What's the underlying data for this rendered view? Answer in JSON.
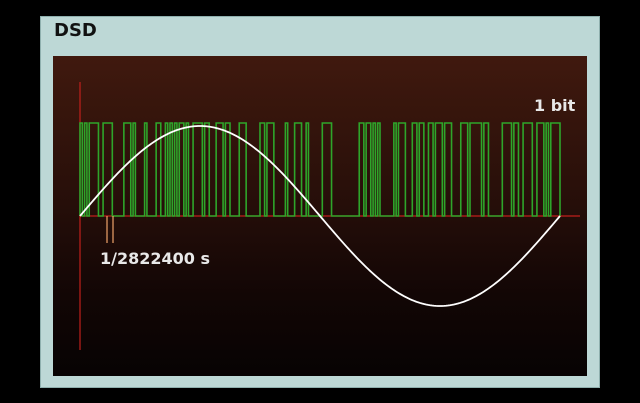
{
  "title": "DSD",
  "bit_label": "1 bit",
  "period_label": "1/2822400 s",
  "colors": {
    "frame": "#bdd8d6",
    "axis": "#c0201c",
    "sine": "#ffffff",
    "pulses": "#2ea52a",
    "sample_marker": "#f0a46a",
    "label_text": "#e8e8e8"
  },
  "pulse_bits": [
    1,
    0,
    1,
    0,
    1,
    1,
    1,
    1,
    0,
    0,
    1,
    1,
    1,
    1,
    0,
    0,
    0,
    0,
    0,
    1,
    1,
    1,
    0,
    1,
    0,
    0,
    0,
    0,
    1,
    0,
    0,
    0,
    0,
    1,
    1,
    0,
    0,
    1,
    0,
    1,
    0,
    1,
    0,
    1,
    1,
    0,
    1,
    0,
    0,
    1,
    1,
    1,
    1,
    0,
    1,
    1,
    0,
    0,
    0,
    1,
    1,
    1,
    0,
    1,
    1,
    0,
    0,
    0,
    0,
    1,
    1,
    1,
    0,
    0,
    0,
    0,
    0,
    0,
    1,
    1,
    0,
    1,
    1,
    1,
    0,
    0,
    0,
    0,
    0,
    1,
    0,
    0,
    0,
    1,
    1,
    1,
    0,
    0,
    1,
    0,
    0,
    0,
    0,
    0,
    0,
    1,
    1,
    1,
    1,
    0,
    0,
    0,
    0,
    0,
    0,
    0,
    0,
    0,
    0,
    0,
    0,
    1,
    1,
    0,
    1,
    1,
    0,
    1,
    0,
    1,
    0,
    0,
    0,
    0,
    0,
    0,
    1,
    0,
    1,
    1,
    1,
    0,
    0,
    0,
    1,
    1,
    0,
    1,
    1,
    0,
    0,
    1,
    1,
    0,
    1,
    1,
    1,
    0,
    1,
    1,
    1,
    0,
    0,
    0,
    0,
    1,
    1,
    1,
    0,
    1,
    1,
    1,
    1,
    1,
    0,
    1,
    1,
    0,
    0,
    0,
    0,
    0,
    0,
    1,
    1,
    1,
    1,
    0,
    1,
    1,
    0,
    0,
    1,
    1,
    1,
    1,
    0,
    0,
    1,
    1,
    1,
    0,
    1,
    0,
    1,
    1,
    1,
    1
  ]
}
